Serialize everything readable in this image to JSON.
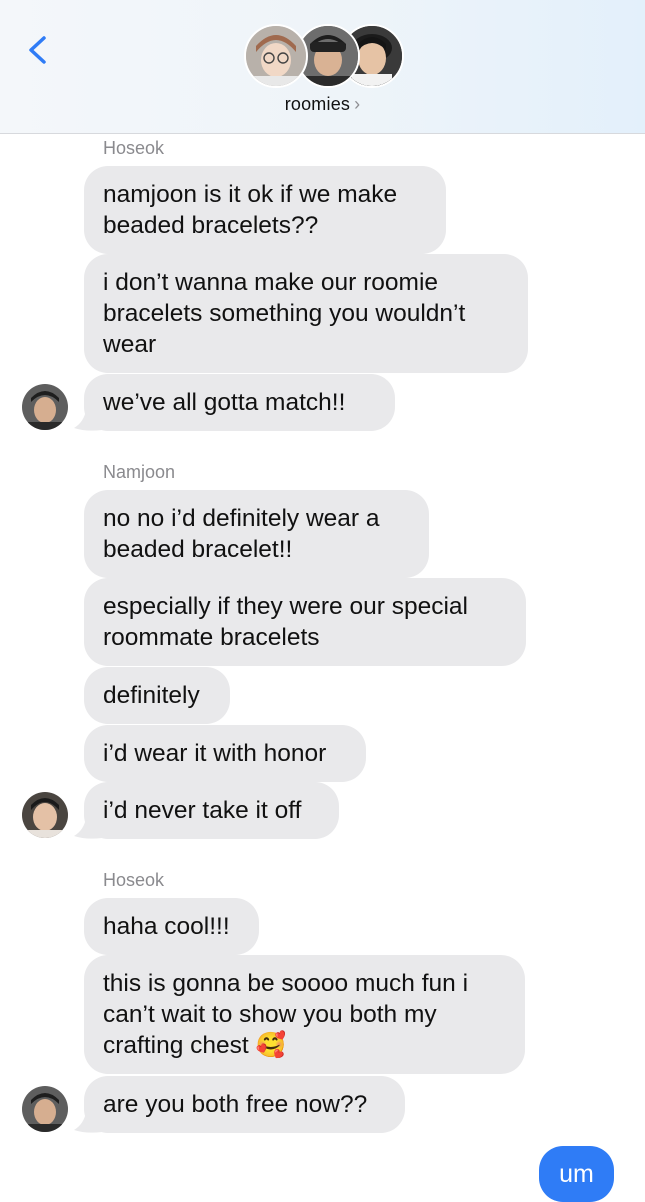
{
  "header": {
    "group_name": "roomies",
    "chevron": "›",
    "back_icon": "chevron-left-icon",
    "accent": "#2f7cf6"
  },
  "messages": [
    {
      "sender": "Hoseok",
      "bubbles": [
        "namjoon is it ok if we make beaded bracelets??",
        "i don’t wanna make our roomie bracelets something you wouldn’t wear",
        "we’ve all gotta match!!"
      ]
    },
    {
      "sender": "Namjoon",
      "bubbles": [
        "no no i’d definitely wear a beaded bracelet!!",
        "especially if they were our special roommate bracelets",
        "definitely",
        "i’d wear it with honor",
        "i’d never take it off"
      ]
    },
    {
      "sender": "Hoseok",
      "bubbles": [
        "haha cool!!!",
        "this is gonna be soooo much fun i can’t wait to show you both my crafting chest 🥰",
        "are you both free now??"
      ]
    }
  ],
  "outgoing": [
    "um"
  ]
}
